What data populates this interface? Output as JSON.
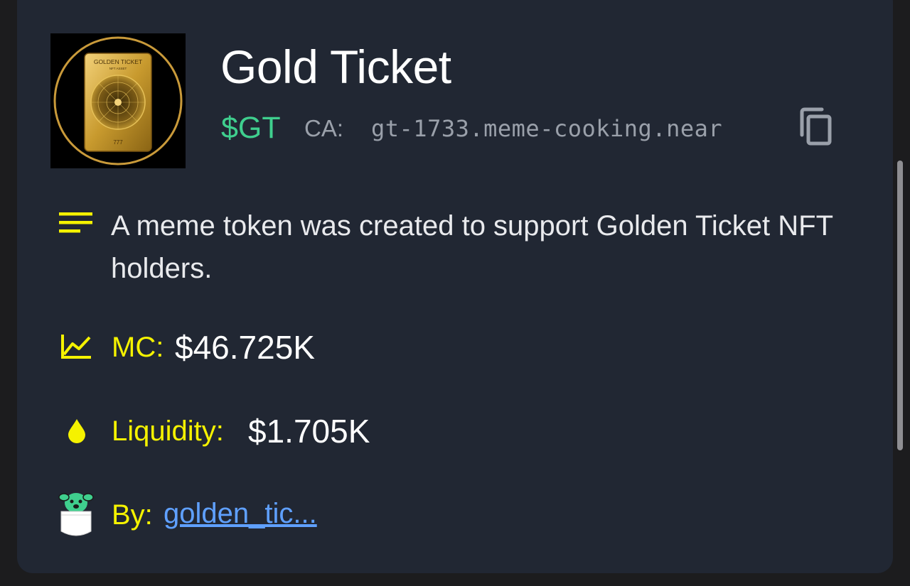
{
  "token": {
    "name": "Gold Ticket",
    "ticker": "$GT",
    "ca_label": "CA:",
    "ca_value": "gt-1733.meme-cooking.near",
    "logo_text": "GOLDEN TICKET",
    "logo_subtext": "NFT ASSET",
    "logo_number": "777"
  },
  "description": "A meme token was created to support Golden Ticket NFT holders.",
  "stats": {
    "mc_label": "MC:",
    "mc_value": "$46.725K",
    "liquidity_label": "Liquidity:",
    "liquidity_value": "$1.705K"
  },
  "creator": {
    "label": "By:",
    "name": "golden_tic..."
  },
  "icons": {
    "copy": "copy-icon",
    "description": "lines-icon",
    "market_cap": "chart-line-icon",
    "liquidity": "droplet-icon",
    "creator": "dog-pocket-icon"
  },
  "colors": {
    "background": "#212733",
    "accent_green": "#3fcf8e",
    "accent_yellow": "#f5f200",
    "link_blue": "#5fa0ff",
    "muted": "#9aa0aa"
  }
}
